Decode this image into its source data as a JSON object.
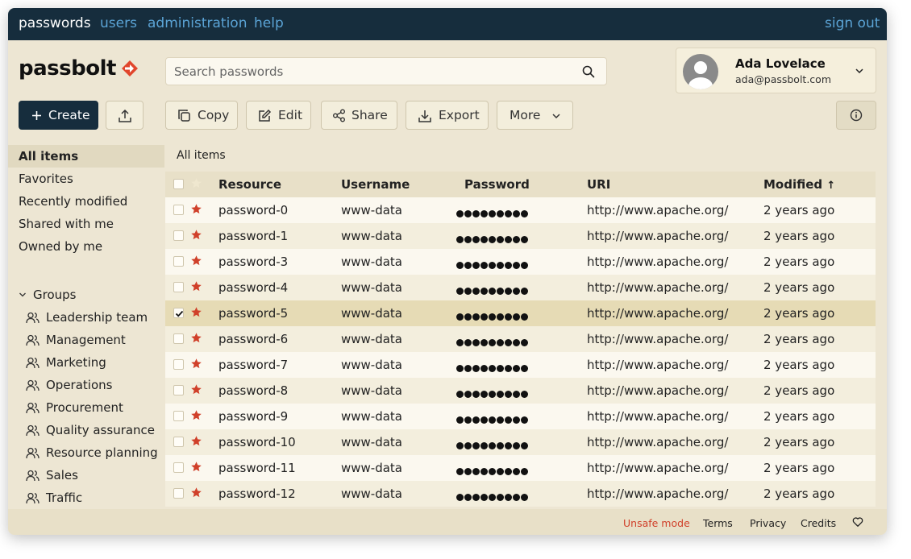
{
  "topnav": {
    "items": [
      "passwords",
      "users",
      "administration",
      "help"
    ],
    "signout": "sign out"
  },
  "logo": {
    "text": "passbolt"
  },
  "search": {
    "placeholder": "Search passwords"
  },
  "profile": {
    "name": "Ada Lovelace",
    "email": "ada@passbolt.com"
  },
  "actions": {
    "create": "Create",
    "copy": "Copy",
    "edit": "Edit",
    "share": "Share",
    "export": "Export",
    "more": "More"
  },
  "sidebar": {
    "filters": [
      "All items",
      "Favorites",
      "Recently modified",
      "Shared with me",
      "Owned by me"
    ],
    "groups_title": "Groups",
    "groups": [
      "Leadership team",
      "Management",
      "Marketing",
      "Operations",
      "Procurement",
      "Quality assurance",
      "Resource planning",
      "Sales",
      "Traffic"
    ]
  },
  "breadcrumb": "All items",
  "table": {
    "columns": [
      "Resource",
      "Username",
      "Password",
      "URI",
      "Modified"
    ],
    "sort_indicator": "↑",
    "rows": [
      {
        "resource": "password-0",
        "username": "www-data",
        "uri": "http://www.apache.org/",
        "modified": "2 years ago",
        "selected": false
      },
      {
        "resource": "password-1",
        "username": "www-data",
        "uri": "http://www.apache.org/",
        "modified": "2 years ago",
        "selected": false
      },
      {
        "resource": "password-3",
        "username": "www-data",
        "uri": "http://www.apache.org/",
        "modified": "2 years ago",
        "selected": false
      },
      {
        "resource": "password-4",
        "username": "www-data",
        "uri": "http://www.apache.org/",
        "modified": "2 years ago",
        "selected": false
      },
      {
        "resource": "password-5",
        "username": "www-data",
        "uri": "http://www.apache.org/",
        "modified": "2 years ago",
        "selected": true
      },
      {
        "resource": "password-6",
        "username": "www-data",
        "uri": "http://www.apache.org/",
        "modified": "2 years ago",
        "selected": false
      },
      {
        "resource": "password-7",
        "username": "www-data",
        "uri": "http://www.apache.org/",
        "modified": "2 years ago",
        "selected": false
      },
      {
        "resource": "password-8",
        "username": "www-data",
        "uri": "http://www.apache.org/",
        "modified": "2 years ago",
        "selected": false
      },
      {
        "resource": "password-9",
        "username": "www-data",
        "uri": "http://www.apache.org/",
        "modified": "2 years ago",
        "selected": false
      },
      {
        "resource": "password-10",
        "username": "www-data",
        "uri": "http://www.apache.org/",
        "modified": "2 years ago",
        "selected": false
      },
      {
        "resource": "password-11",
        "username": "www-data",
        "uri": "http://www.apache.org/",
        "modified": "2 years ago",
        "selected": false
      },
      {
        "resource": "password-12",
        "username": "www-data",
        "uri": "http://www.apache.org/",
        "modified": "2 years ago",
        "selected": false
      }
    ]
  },
  "footer": {
    "unsafe": "Unsafe mode",
    "terms": "Terms",
    "privacy": "Privacy",
    "credits": "Credits"
  },
  "colors": {
    "navy": "#162d3d",
    "accent_blue": "#5ba4d6",
    "star_red": "#d0402a",
    "unsafe_red": "#d0402a",
    "background": "#ede6d3"
  },
  "icons": [
    "search-icon",
    "chevron-down-icon",
    "plus-icon",
    "upload-icon",
    "copy-icon",
    "edit-icon",
    "share-icon",
    "export-icon",
    "info-icon",
    "group-icon",
    "star-icon",
    "heart-icon",
    "check-icon"
  ]
}
